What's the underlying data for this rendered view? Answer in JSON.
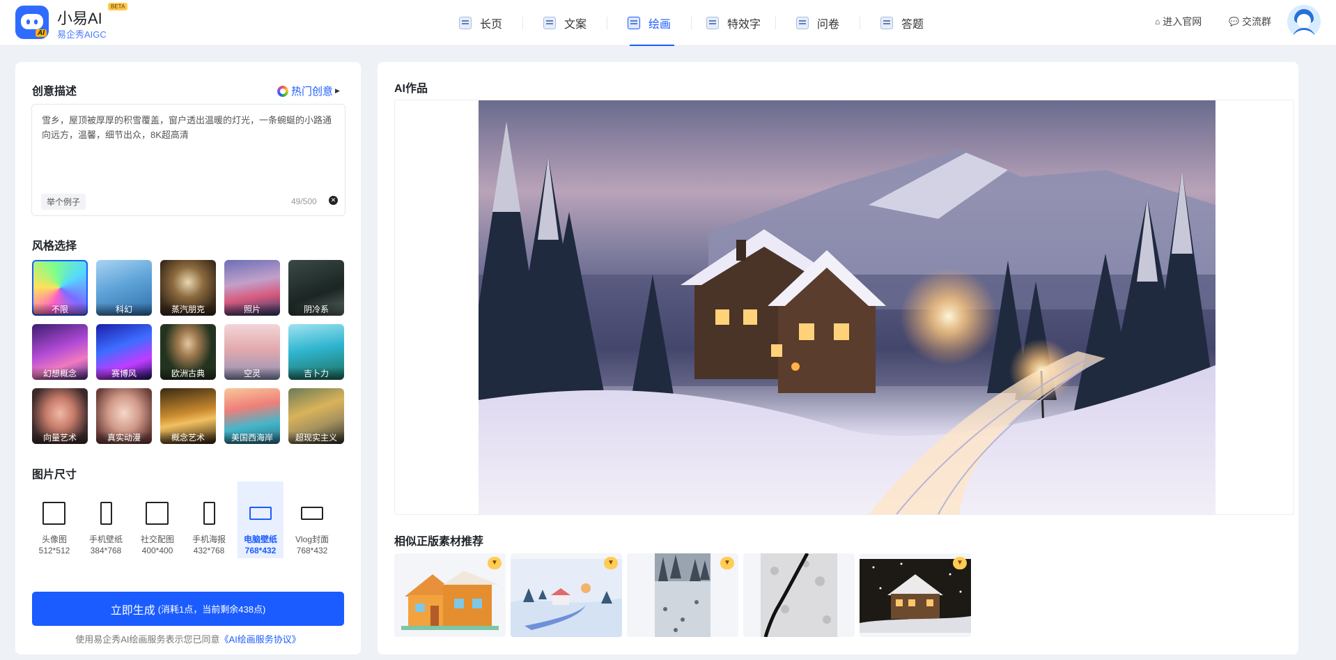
{
  "header": {
    "brand": {
      "name": "小易AI",
      "badge": "BETA",
      "subtitle": "易企秀AIGC",
      "logo_text": "AI"
    },
    "nav": [
      {
        "label": "长页",
        "icon": "long-page-icon"
      },
      {
        "label": "文案",
        "icon": "copywriting-icon"
      },
      {
        "label": "绘画",
        "icon": "painting-icon",
        "active": true
      },
      {
        "label": "特效字",
        "icon": "effect-text-icon"
      },
      {
        "label": "问卷",
        "icon": "survey-icon"
      },
      {
        "label": "答题",
        "icon": "quiz-icon"
      }
    ],
    "links": [
      {
        "label": "进入官网",
        "icon": "home-icon"
      },
      {
        "label": "交流群",
        "icon": "chat-icon"
      }
    ]
  },
  "left": {
    "prompt": {
      "title": "创意描述",
      "hot_label": "热门创意",
      "text": "雪乡，屋顶被厚厚的积雪覆盖，窗户透出温暖的灯光，一条蜿蜒的小路通向远方，温馨，细节出众，8K超高清",
      "example_label": "举个例子",
      "counter": "49/500"
    },
    "style": {
      "title": "风格选择",
      "items": [
        {
          "label": "不限",
          "selected": true
        },
        {
          "label": "科幻"
        },
        {
          "label": "蒸汽朋克"
        },
        {
          "label": "照片"
        },
        {
          "label": "阴冷系"
        },
        {
          "label": "幻想概念"
        },
        {
          "label": "赛博风"
        },
        {
          "label": "欧洲古典"
        },
        {
          "label": "空灵"
        },
        {
          "label": "吉卜力"
        },
        {
          "label": "向量艺术"
        },
        {
          "label": "真实动漫"
        },
        {
          "label": "概念艺术"
        },
        {
          "label": "美国西海岸"
        },
        {
          "label": "超现实主义"
        }
      ]
    },
    "size": {
      "title": "图片尺寸",
      "items": [
        {
          "name": "头像图",
          "dim": "512*512"
        },
        {
          "name": "手机壁纸",
          "dim": "384*768"
        },
        {
          "name": "社交配图",
          "dim": "400*400"
        },
        {
          "name": "手机海报",
          "dim": "432*768"
        },
        {
          "name": "电脑壁纸",
          "dim": "768*432",
          "selected": true
        },
        {
          "name": "Vlog封面",
          "dim": "768*432"
        }
      ]
    },
    "generate": {
      "label": "立即生成",
      "sub": "(消耗1点，当前剩余438点)"
    },
    "agreement": {
      "text": "使用易企秀AI绘画服务表示您已同意",
      "link": "《AI绘画服务协议》"
    }
  },
  "right": {
    "title": "AI作品",
    "recommend_title": "相似正版素材推荐",
    "recommend_count": 5
  },
  "colors": {
    "accent": "#1a5cff",
    "background": "#eef2f7",
    "premium": "#ffcc55"
  }
}
